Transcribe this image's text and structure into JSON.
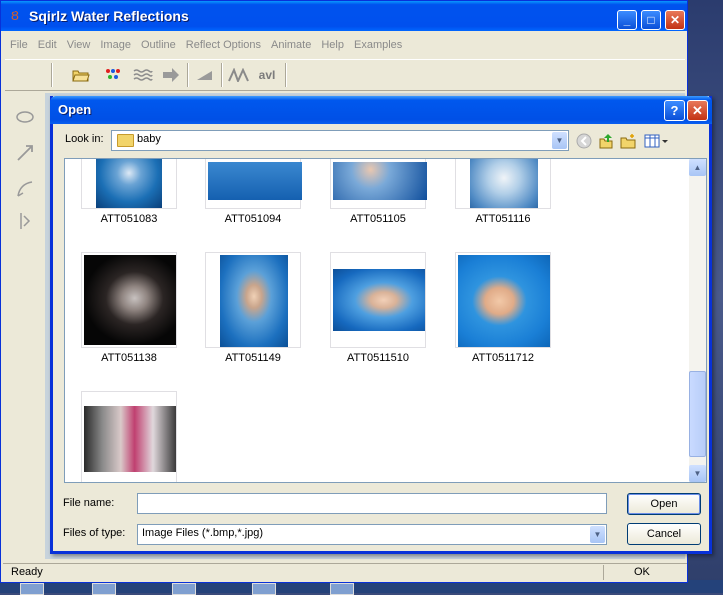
{
  "app": {
    "title": "Sqirlz Water Reflections",
    "menu": [
      "File",
      "Edit",
      "View",
      "Image",
      "Outline",
      "Reflect Options",
      "Animate",
      "Help",
      "Examples"
    ],
    "toolbar": {
      "avi_label": "avI",
      "icons": [
        "open-folder-icon",
        "color-dots-icon",
        "waves-icon",
        "arrow-right-icon",
        "wedge-icon",
        "zigzag-icon"
      ]
    },
    "status": {
      "left": "Ready",
      "right": "OK"
    }
  },
  "dialog": {
    "title": "Open",
    "help_button": "?",
    "look_in_label": "Look in:",
    "look_in_value": "baby",
    "files": [
      {
        "name": "ATT051083"
      },
      {
        "name": "ATT051094"
      },
      {
        "name": "ATT051105"
      },
      {
        "name": "ATT051116"
      },
      {
        "name": "ATT051138"
      },
      {
        "name": "ATT051149"
      },
      {
        "name": "ATT0511510"
      },
      {
        "name": "ATT0511712"
      },
      {
        "name": ""
      }
    ],
    "file_name_label": "File name:",
    "file_name_value": "",
    "files_of_type_label": "Files of type:",
    "files_of_type_value": "Image Files (*.bmp,*.jpg)",
    "open_button": "Open",
    "cancel_button": "Cancel"
  }
}
